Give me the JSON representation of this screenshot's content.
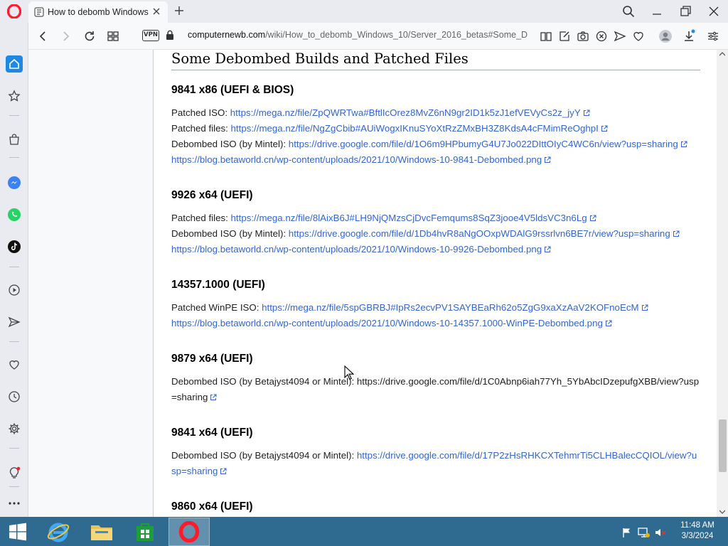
{
  "browser": {
    "tab_title": "How to debomb Windows",
    "url_domain": "computernewb.com",
    "url_path": "/wiki/How_to_debomb_Windows_10/Server_2016_betas#Some_D",
    "vpn_label": "VPN",
    "accent_color": "#ff1b2d"
  },
  "sidebar": {
    "items": [
      "home-icon",
      "speed-dial-icon",
      "shopping-icon",
      "messenger-icon",
      "whatsapp-icon",
      "tiktok-icon",
      "player-icon",
      "send-icon",
      "heart-icon",
      "history-icon",
      "settings-icon",
      "bulb-icon",
      "more-icon"
    ]
  },
  "article": {
    "section_title": "Some Debombed Builds and Patched Files",
    "builds": [
      {
        "heading": "9841 x86 (UEFI & BIOS)",
        "lines": [
          {
            "label": "Patched ISO: ",
            "link": "https://mega.nz/file/ZpQWRTwa#BftlIcOrez8MvZ6nN9gr2ID1k5zJ1efVEVyCs2z_jyY"
          },
          {
            "label": "Patched files: ",
            "link": "https://mega.nz/file/NgZgCbib#AUiWogxIKnuSYoXtRzZMxBH3Z8KdsA4cFMimReOghpI"
          },
          {
            "label": "Debombed ISO (by Mintel): ",
            "link": "https://drive.google.com/file/d/1O6m9HPbumyG4U7Jo022DIttOIyC4WC6n/view?usp=sharing"
          },
          {
            "label": "",
            "link": "https://blog.betaworld.cn/wp-content/uploads/2021/10/Windows-10-9841-Debombed.png"
          }
        ]
      },
      {
        "heading": "9926 x64 (UEFI)",
        "lines": [
          {
            "label": "Patched files: ",
            "link": "https://mega.nz/file/8lAixB6J#LH9NjQMzsCjDvcFemqums8SqZ3jooe4V5ldsVC3n6Lg"
          },
          {
            "label": "Debombed ISO (by Mintel): ",
            "link": "https://drive.google.com/file/d/1Db4hvR8aNgOOxpWDAlG9rssrlvn6BE7r/view?usp=sharing"
          },
          {
            "label": "",
            "link": "https://blog.betaworld.cn/wp-content/uploads/2021/10/Windows-10-9926-Debombed.png"
          }
        ]
      },
      {
        "heading": "14357.1000 (UEFI)",
        "lines": [
          {
            "label": "Patched WinPE ISO: ",
            "link": "https://mega.nz/file/5spGBRBJ#IpRs2ecvPV1SAYBEaRh62o5ZgG9xaXzAaV2KOFnoEcM"
          },
          {
            "label": "",
            "link": "https://blog.betaworld.cn/wp-content/uploads/2021/10/Windows-10-14357.1000-WinPE-Debombed.png"
          }
        ]
      },
      {
        "heading": "9879 x64 (UEFI)",
        "lines": [
          {
            "label": "Debombed ISO (by Betajyst4094 or Mintel): ",
            "link": "",
            "plain": "https://drive.google.com/file/d/1C0Abnp6iah77Yh_5YbAbcIDzepufgXBB/view?usp=sharing"
          }
        ]
      },
      {
        "heading": "9841 x64 (UEFI)",
        "lines": [
          {
            "label": "Debombed ISO (by Betajyst4094 or Mintel): ",
            "link": "https://drive.google.com/file/d/17P2zHsRHKCXTehmrTi5CLHBalecCQIOL/view?usp=sharing"
          }
        ]
      },
      {
        "heading": "9860 x64 (UEFI)",
        "lines": []
      }
    ]
  },
  "taskbar": {
    "apps": [
      "internet-explorer-icon",
      "file-explorer-icon",
      "store-icon",
      "opera-icon"
    ],
    "time": "11:48 AM",
    "date": "3/3/2024"
  }
}
